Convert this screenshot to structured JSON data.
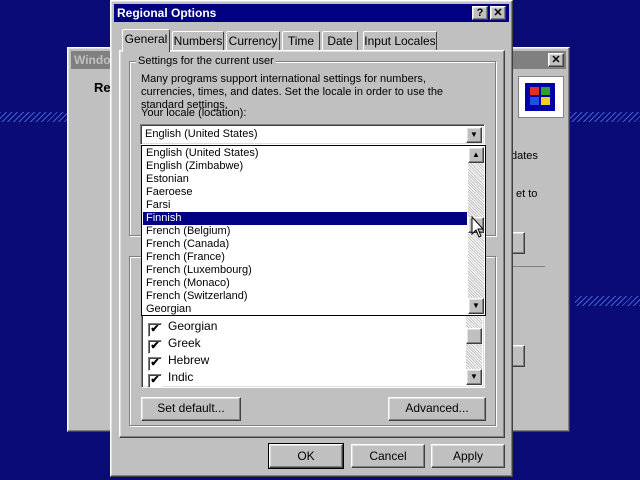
{
  "colors": {
    "desktop": "#0b0b77",
    "title_active": "#000080",
    "title_inactive": "#808080",
    "selection": "#000080"
  },
  "bg_window": {
    "title": "Window",
    "heading": "Re",
    "right_text_1": "dates",
    "right_text_2": "et to",
    "close_icon": "close-icon",
    "logo_icon": "windows-logo-icon"
  },
  "dialog": {
    "title": "Regional Options",
    "help_label": "?",
    "close_label": "✕",
    "tabs": [
      {
        "label": "General"
      },
      {
        "label": "Numbers"
      },
      {
        "label": "Currency"
      },
      {
        "label": "Time"
      },
      {
        "label": "Date"
      },
      {
        "label": "Input Locales"
      }
    ],
    "group_title": "Settings for the current user",
    "description": "Many programs support international settings for numbers, currencies, times, and dates. Set the locale in order to use the standard settings.",
    "locale_label": "Your locale (location):",
    "locale_value": "English (United States)",
    "dropdown_items": [
      "English (United States)",
      "English (Zimbabwe)",
      "Estonian",
      "Faeroese",
      "Farsi",
      "Finnish",
      "French (Belgium)",
      "French (Canada)",
      "French (France)",
      "French (Luxembourg)",
      "French (Monaco)",
      "French (Switzerland)",
      "Georgian"
    ],
    "selected_item": "Finnish",
    "language_items": [
      {
        "label": "Georgian",
        "checked": true
      },
      {
        "label": "Greek",
        "checked": true
      },
      {
        "label": "Hebrew",
        "checked": true
      },
      {
        "label": "Indic",
        "checked": true
      }
    ],
    "set_default_label": "Set default...",
    "advanced_label": "Advanced...",
    "ok_label": "OK",
    "cancel_label": "Cancel",
    "apply_label": "Apply"
  }
}
